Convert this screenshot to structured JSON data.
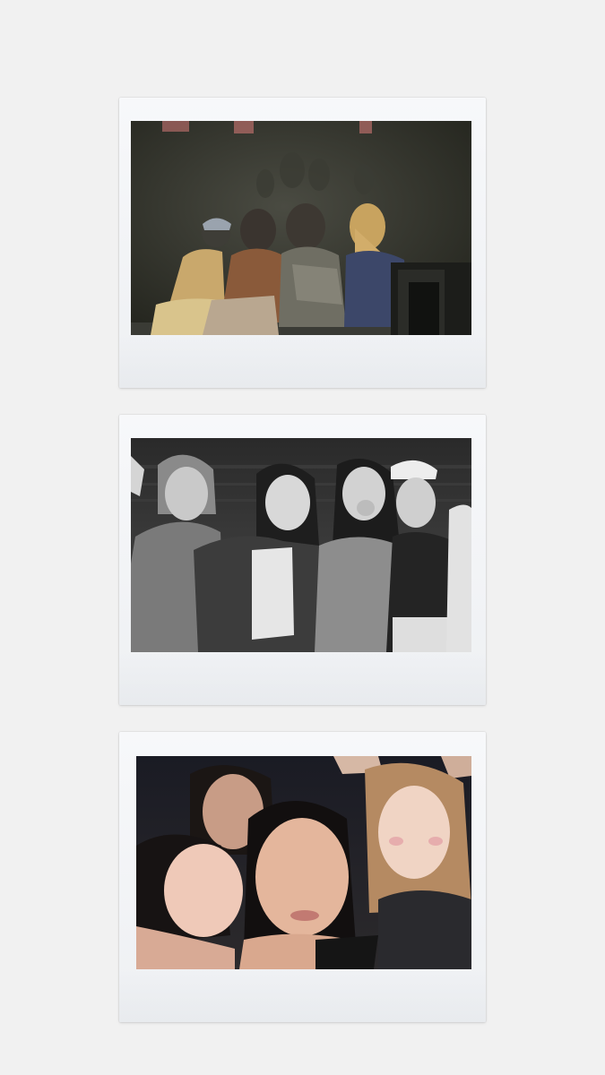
{
  "photos": [
    {
      "id": "photo-1",
      "subject": "four-performers-seated-on-stage-viewed-from-behind",
      "tone": "desaturated-dark-stage"
    },
    {
      "id": "photo-2",
      "subject": "four-performers-posing-group-shot",
      "tone": "black-and-white"
    },
    {
      "id": "photo-3",
      "subject": "four-performers-close-up-selfie",
      "tone": "color-warm"
    }
  ],
  "colors": {
    "background": "#f1f1f1",
    "frame": "#f5f6f8",
    "stage_dark": "#2f302a",
    "stage_highlight": "#c9a36b"
  }
}
